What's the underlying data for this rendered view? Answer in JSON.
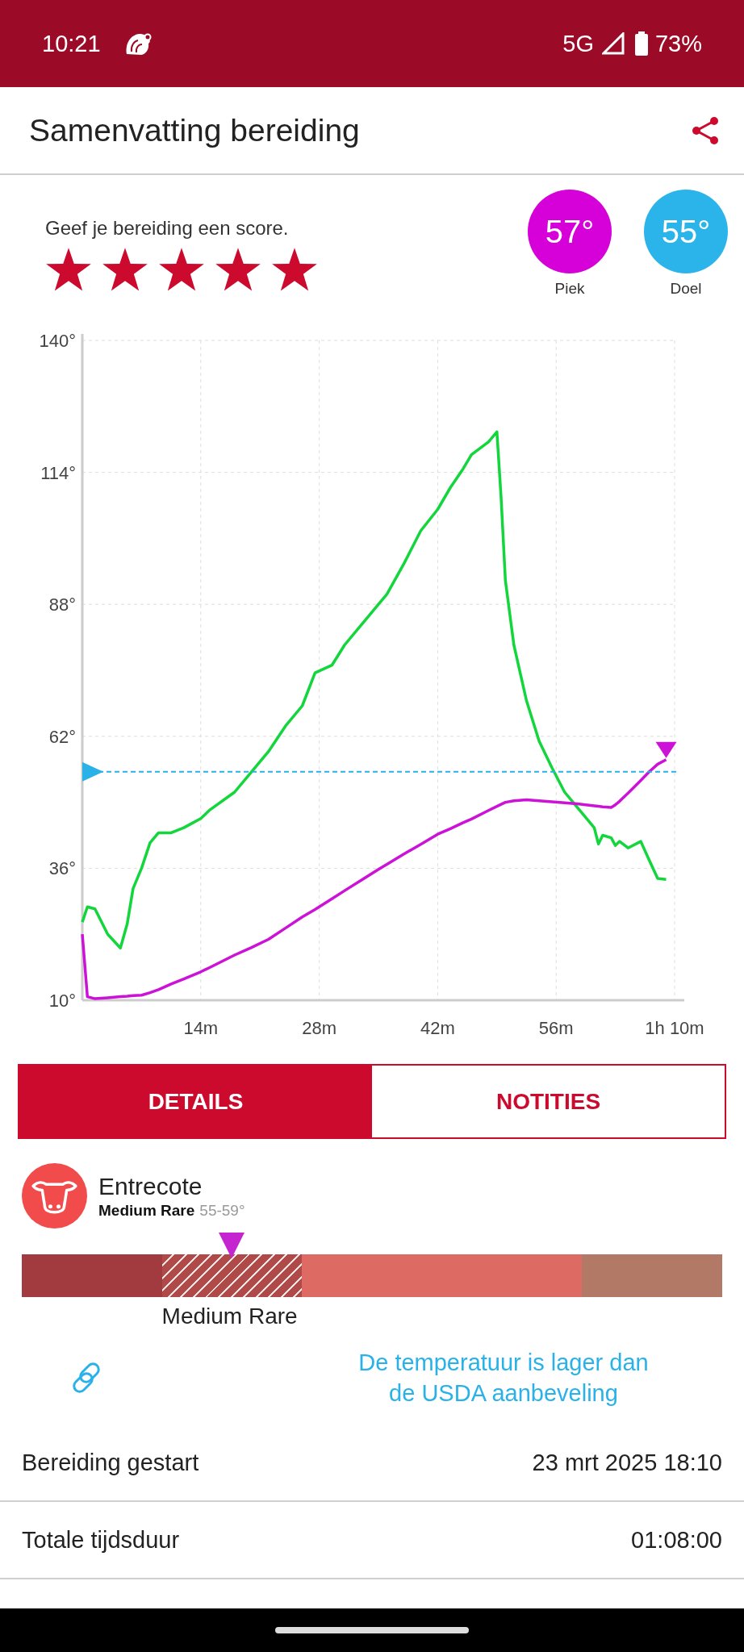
{
  "status_bar": {
    "time": "10:21",
    "network": "5G",
    "battery": "73%"
  },
  "header": {
    "title": "Samenvatting bereiding"
  },
  "rating": {
    "prompt": "Geef je bereiding een score.",
    "stars": 5
  },
  "temperatures": [
    {
      "value": "57°",
      "label": "Piek",
      "color": "#d600d8"
    },
    {
      "value": "55°",
      "label": "Doel",
      "color": "#2bb4ea"
    }
  ],
  "chart_data": {
    "type": "line",
    "x": [
      0,
      0.6,
      1.5,
      3,
      4.5,
      5.3,
      6,
      7,
      8,
      9,
      10.5,
      12,
      14,
      15,
      18,
      20,
      22,
      24,
      26,
      27.5,
      29.5,
      31,
      33,
      35,
      36,
      38,
      40,
      42,
      43.5,
      45,
      46,
      48,
      49,
      49.5,
      50,
      51,
      52.5,
      54,
      55.5,
      57,
      58.5,
      60.5,
      61,
      61.5,
      62.5,
      63,
      63.5,
      64.5,
      66,
      67,
      68,
      69
    ],
    "series": [
      {
        "color": "#12d63c",
        "values": [
          25.4,
          28.4,
          28,
          23,
          20.3,
          25,
          32,
          36,
          41,
          43,
          43,
          44,
          45.8,
          47.4,
          51,
          55,
          59,
          64,
          68,
          74.5,
          76,
          80,
          84,
          88,
          90,
          96,
          102.5,
          106.7,
          111,
          114.7,
          117.5,
          120,
          122,
          109,
          92.7,
          80,
          69,
          61,
          55.8,
          51,
          48,
          44,
          40.8,
          42.5,
          42,
          40.5,
          41.3,
          40,
          41.3,
          37.6,
          34,
          33.8
        ]
      },
      {
        "color": "#cc12d6",
        "values": [
          23,
          10.7,
          10.3,
          10.5,
          10.7,
          10.8,
          10.9,
          11,
          11.5,
          12.1,
          13.2,
          14.2,
          15.6,
          16.4,
          18.9,
          20.4,
          22,
          24.2,
          26.4,
          27.9,
          30,
          31.6,
          33.7,
          35.8,
          36.8,
          38.8,
          40.7,
          42.7,
          43.8,
          45,
          45.7,
          47.4,
          48.2,
          48.6,
          49,
          49.3,
          49.5,
          49.3,
          49.1,
          48.9,
          48.7,
          48.3,
          48.2,
          48.1,
          48,
          48.5,
          49.2,
          50.8,
          53.3,
          55,
          56.5,
          57.4
        ]
      }
    ],
    "xlim": [
      0,
      70
    ],
    "ylim": [
      10,
      140
    ],
    "xticks": [
      {
        "value": 14,
        "label": "14m"
      },
      {
        "value": 28,
        "label": "28m"
      },
      {
        "value": 42,
        "label": "42m"
      },
      {
        "value": 56,
        "label": "56m"
      },
      {
        "value": 70,
        "label": "1h 10m"
      }
    ],
    "yticks": [
      {
        "value": 10,
        "label": "10°"
      },
      {
        "value": 36,
        "label": "36°"
      },
      {
        "value": 62,
        "label": "62°"
      },
      {
        "value": 88,
        "label": "88°"
      },
      {
        "value": 114,
        "label": "114°"
      },
      {
        "value": 140,
        "label": "140°"
      }
    ],
    "grid": true,
    "ref_lines": [
      {
        "axis": "y",
        "value": 55
      }
    ]
  },
  "tabs": [
    {
      "label": "DETAILS",
      "selected": true
    },
    {
      "label": "NOTITIES",
      "selected": false
    }
  ],
  "product": {
    "name": "Entrecote",
    "doneness": "Medium Rare",
    "range": "55-59°"
  },
  "doneness_bar": {
    "segments": [
      {
        "color": "#a23b3f",
        "selected": false
      },
      {
        "color": "#b04a48",
        "selected": true,
        "label": "Medium Rare"
      },
      {
        "color": "#dd6b63",
        "selected": false
      },
      {
        "color": "#b27a66",
        "selected": false
      }
    ]
  },
  "notice": "De temperatuur is lager dan de USDA aanbeveling",
  "details": [
    {
      "label": "Bereiding gestart",
      "value": "23 mrt 2025 18:10"
    },
    {
      "label": "Totale tijdsduur",
      "value": "01:08:00"
    }
  ]
}
